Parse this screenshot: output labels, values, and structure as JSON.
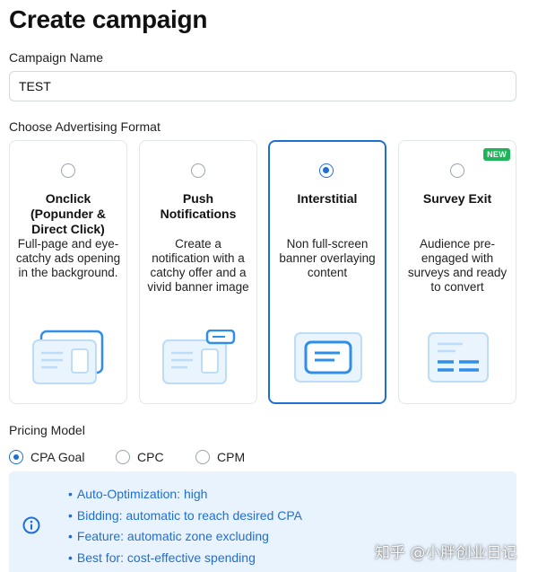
{
  "page": {
    "title": "Create campaign"
  },
  "campaign_name": {
    "label": "Campaign Name",
    "value": "TEST"
  },
  "format": {
    "label": "Choose Advertising Format",
    "options": [
      {
        "title": "Onclick (Popunder & Direct Click)",
        "description": "Full-page and eye-catchy ads opening in the background.",
        "selected": false,
        "icon": "popunder-windows-icon"
      },
      {
        "title": "Push Notifications",
        "description": "Create a notification with a catchy offer and a vivid banner image",
        "selected": false,
        "icon": "push-notification-icon"
      },
      {
        "title": "Interstitial",
        "description": "Non full-screen banner overlaying content",
        "selected": true,
        "icon": "interstitial-banner-icon"
      },
      {
        "title": "Survey Exit",
        "description": "Audience pre-engaged with surveys and ready to convert",
        "selected": false,
        "badge": "NEW",
        "icon": "survey-form-icon"
      }
    ]
  },
  "pricing": {
    "label": "Pricing Model",
    "options": [
      {
        "label": "CPA Goal",
        "checked": true
      },
      {
        "label": "CPC",
        "checked": false
      },
      {
        "label": "CPM",
        "checked": false
      }
    ],
    "info": [
      "Auto-Optimization: high",
      "Bidding: automatic to reach desired CPA",
      "Feature: automatic zone excluding",
      "Best for: cost-effective spending"
    ]
  },
  "watermark": "知乎 @小胖创业日记",
  "colors": {
    "accent": "#1f6fd1",
    "info_bg": "#e9f3fd",
    "badge": "#1fb45a",
    "illustration": "#2f8fe8"
  }
}
